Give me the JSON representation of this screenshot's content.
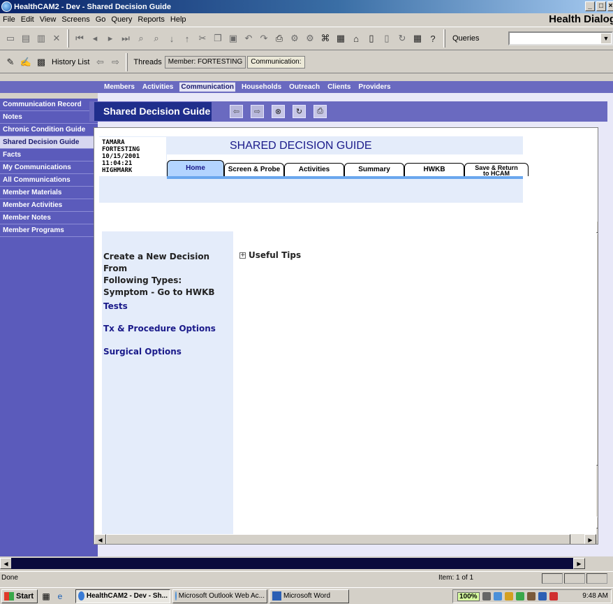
{
  "window": {
    "title": "HealthCAM2 - Dev - Shared Decision Guide",
    "controls": [
      "_",
      "□",
      "×"
    ]
  },
  "menubar": {
    "items": [
      "File",
      "Edit",
      "View",
      "Screens",
      "Go",
      "Query",
      "Reports",
      "Help"
    ],
    "brand": "Health Dialog"
  },
  "toolbar": {
    "queries_label": "Queries",
    "queries_value": ""
  },
  "history": {
    "label": "History List",
    "threads_label": "Threads",
    "member_crumb": "Member: FORTESTING",
    "communication_crumb": "Communication:"
  },
  "nav": {
    "items": [
      {
        "label": "Members",
        "active": false
      },
      {
        "label": "Activities",
        "active": false
      },
      {
        "label": "Communication",
        "active": true
      },
      {
        "label": "Households",
        "active": false
      },
      {
        "label": "Outreach",
        "active": false
      },
      {
        "label": "Clients",
        "active": false
      },
      {
        "label": "Providers",
        "active": false
      }
    ]
  },
  "sidebar": {
    "items": [
      {
        "label": "Communication Record",
        "active": false
      },
      {
        "label": "Notes",
        "active": false
      },
      {
        "label": "Chronic Condition Guide",
        "active": false
      },
      {
        "label": "Shared Decision Guide",
        "active": true
      },
      {
        "label": "Facts",
        "active": false
      },
      {
        "label": "My Communications",
        "active": false
      },
      {
        "label": "All Communications",
        "active": false
      },
      {
        "label": "Member Materials",
        "active": false
      },
      {
        "label": "Member Activities",
        "active": false
      },
      {
        "label": "Member Notes",
        "active": false
      },
      {
        "label": "Member Programs",
        "active": false
      }
    ]
  },
  "panel": {
    "title": "Shared Decision Guide"
  },
  "member": {
    "first_name": "TAMARA",
    "last_name": "FORTESTING",
    "date": "10/15/2001",
    "time": "11:04:21",
    "plan": "HIGHMARK"
  },
  "sdg": {
    "heading": "SHARED DECISION GUIDE",
    "tabs": {
      "home": "Home",
      "screen": "Screen & Probe",
      "activities": "Activities",
      "summary": "Summary",
      "hwkb": "HWKB",
      "save_line1": "Save & Return",
      "save_line2": "to HCAM"
    }
  },
  "decision": {
    "create_line1": "Create a New Decision From",
    "create_line2": "Following Types:",
    "symptom": "Symptom - Go to HWKB",
    "tests": "Tests",
    "tx_options": "Tx & Procedure Options",
    "surgical": "Surgical Options"
  },
  "tips": {
    "label": "Useful Tips",
    "expander": "+"
  },
  "statusbar": {
    "left": "Done",
    "item": "Item: 1 of 1"
  },
  "taskbar": {
    "start": "Start",
    "tasks": [
      {
        "label": "HealthCAM2 - Dev - Sh...",
        "active": true
      },
      {
        "label": "Microsoft Outlook Web Ac...",
        "active": false
      },
      {
        "label": "Microsoft Word",
        "active": false
      }
    ],
    "zoom": "100%",
    "clock": "9:48 AM"
  }
}
